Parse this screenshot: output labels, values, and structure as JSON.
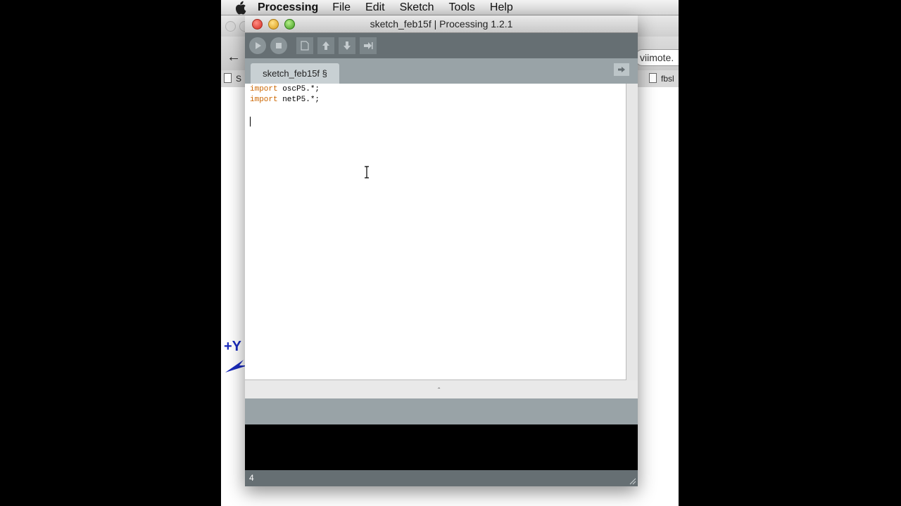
{
  "menubar": {
    "items": [
      "Processing",
      "File",
      "Edit",
      "Sketch",
      "Tools",
      "Help"
    ]
  },
  "background_window": {
    "url_fragment": "viimote.",
    "bookmark_right": "fbsl",
    "bookmark_left": "S",
    "annotation_label": "+Y"
  },
  "processing": {
    "window_title": "sketch_feb15f | Processing 1.2.1",
    "tab_label": "sketch_feb15f §",
    "code_lines": [
      {
        "keyword": "import",
        "rest": " oscP5.*;"
      },
      {
        "keyword": "import",
        "rest": " netP5.*;"
      }
    ],
    "line_number": "4",
    "colors": {
      "toolbar": "#666f73",
      "tabbar": "#99a3a7",
      "keyword": "#cc6600"
    }
  }
}
